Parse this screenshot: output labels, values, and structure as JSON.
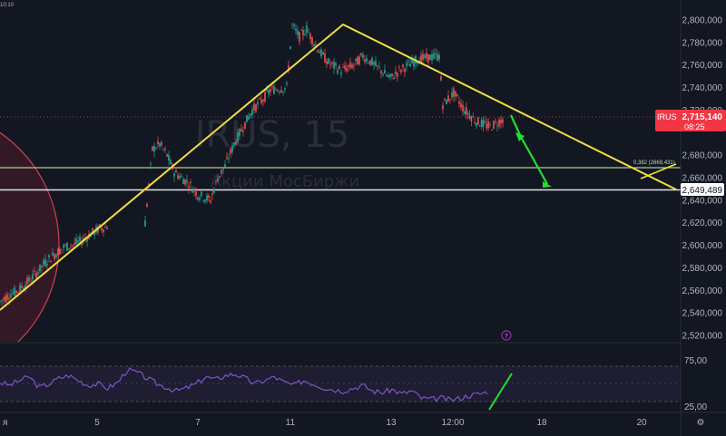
{
  "header": {
    "corner_label": "10:10"
  },
  "watermark": {
    "symbol_line": "IRUS, 15",
    "exchange_line": "Акции МосБиржи"
  },
  "chart_data": {
    "type": "line",
    "ylim": [
      2510,
      2812
    ],
    "x_ticks": [
      "я",
      "5",
      "7",
      "11",
      "13",
      "12:00",
      "18",
      "20"
    ],
    "y_ticks": [
      "2,800,000",
      "2,780,000",
      "2,760,000",
      "2,740,000",
      "2,720,000",
      "2,680,000",
      "2,660,000",
      "2,640,000",
      "2,620,000",
      "2,600,000",
      "2,580,000",
      "2,560,000",
      "2,540,000",
      "2,520,000"
    ],
    "price_series": [
      2550,
      2556,
      2560,
      2567,
      2575,
      2585,
      2592,
      2598,
      2600,
      2604,
      2610,
      2615,
      2617,
      2620,
      2685,
      2690,
      2680,
      2665,
      2660,
      2655,
      2645,
      2640,
      2660,
      2670,
      2690,
      2705,
      2720,
      2728,
      2738,
      2740,
      2795,
      2785,
      2792,
      2780,
      2770,
      2762,
      2755,
      2760,
      2768,
      2762,
      2755,
      2748,
      2755,
      2760,
      2765,
      2768,
      2725,
      2735,
      2720,
      2710,
      2705,
      2713
    ],
    "current_price": {
      "ticker": "IRUS",
      "value": "2,715,140",
      "countdown": "08:25"
    },
    "levels": [
      {
        "label": "2,649,489",
        "value": 2649.5,
        "color": "#e0e3eb"
      },
      {
        "label": "0,382 (2669,431)",
        "value": 2669.4,
        "color": "#a8d08d"
      }
    ],
    "rsi": {
      "upper_label": "75,00",
      "lower_label": "25,00"
    },
    "rsi_series": [
      52,
      48,
      55,
      60,
      45,
      50,
      58,
      62,
      55,
      48,
      50,
      44,
      52,
      70,
      66,
      58,
      50,
      45,
      40,
      44,
      50,
      60,
      56,
      62,
      64,
      58,
      50,
      55,
      60,
      52,
      48,
      55,
      50,
      45,
      42,
      40,
      44,
      48,
      40,
      38,
      42,
      36,
      40,
      30,
      28,
      30,
      27,
      30,
      34,
      36,
      40
    ]
  }
}
